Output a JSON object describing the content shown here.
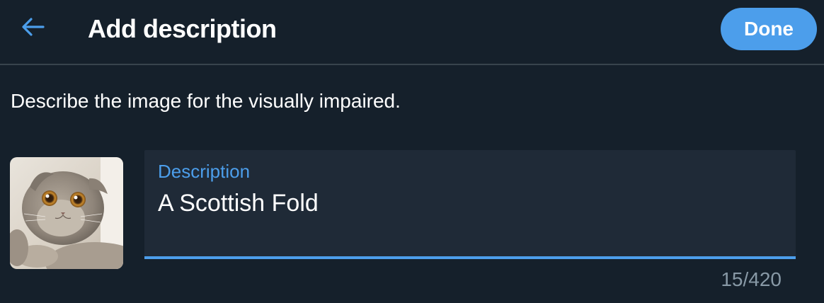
{
  "header": {
    "back_icon": "arrow-left-icon",
    "title": "Add description",
    "done_label": "Done"
  },
  "instruction": "Describe the image for the visually impaired.",
  "image": {
    "icon": "cat-photo-thumbnail"
  },
  "description_field": {
    "label": "Description",
    "value": "A Scottish Fold"
  },
  "counter": "15/420",
  "colors": {
    "background": "#15202b",
    "accent": "#4c9eeb",
    "field_background": "#1f2a37",
    "divider": "#38444d",
    "muted_text": "#8899a6"
  }
}
